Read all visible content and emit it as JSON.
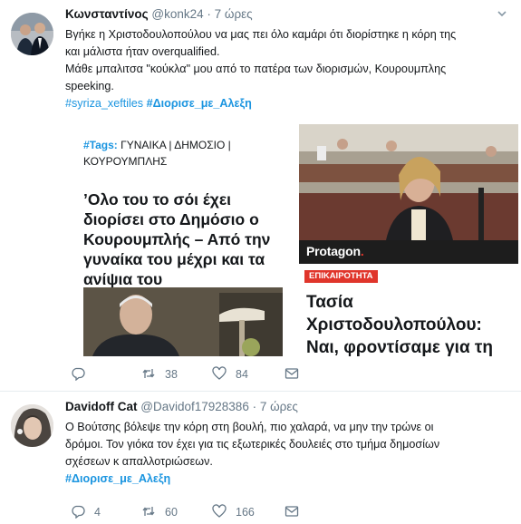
{
  "tweets": [
    {
      "name": "Κωνσταντίνος",
      "handle": "@konk24",
      "separator": "·",
      "time": "7 ώρες",
      "text_lines": [
        "Βγήκε η Χριστοδουλοπούλου να μας πει όλο καμάρι ότι διορίστηκε η κόρη της",
        "και μάλιστα ήταν overqualified.",
        "Μάθε μπαλιτσα \"κούκλα\" μου από το πατέρα των διορισμών, Κουρουμπλης",
        "speeking."
      ],
      "hashtags": [
        "#syriza_xeftiles",
        "#Διορισε_με_Αλεξη"
      ],
      "cards": {
        "left": {
          "tags_label": "#Tags:",
          "tags_text": " ΓΥΝΑΙΚΑ | ΔΗΜΟΣΙΟ | ΚΟΥΡΟΥΜΠΛΗΣ",
          "title": "’Ολο του το σόι έχει διορίσει στο Δημόσιο ο Κουρουμπλής – Από την γυναίκα του μέχρι και τα ανίψια του"
        },
        "right": {
          "brand": "Protagon",
          "brand_dot": ".",
          "category": "ΕΠΙΚΑΙΡΟΤΗΤΑ",
          "title": "Τασία Χριστοδουλοπούλου: Ναι, φροντίσαμε για τη"
        }
      },
      "actions": {
        "reply_count": "",
        "retweet_count": "38",
        "like_count": "84"
      }
    },
    {
      "name": "Davidoff Cat",
      "handle": "@Davidof17928386",
      "separator": "·",
      "time": "7 ώρες",
      "text_lines": [
        "Ο Βούτσης βόλεψε την κόρη στη βουλή, πιο χαλαρά, να μην την τρώνε οι",
        "δρόμοι. Τον γιόκα τον έχει για τις εξωτερικές δουλειές στο τμήμα δημοσίων",
        "σχέσεων κ απαλλοτριώσεων."
      ],
      "hashtags": [
        "#Διορισε_με_Αλεξη"
      ],
      "actions": {
        "reply_count": "4",
        "retweet_count": "60",
        "like_count": "166"
      }
    }
  ],
  "colors": {
    "link": "#1b95e0",
    "muted": "#657786",
    "brand_red": "#e0352b"
  }
}
